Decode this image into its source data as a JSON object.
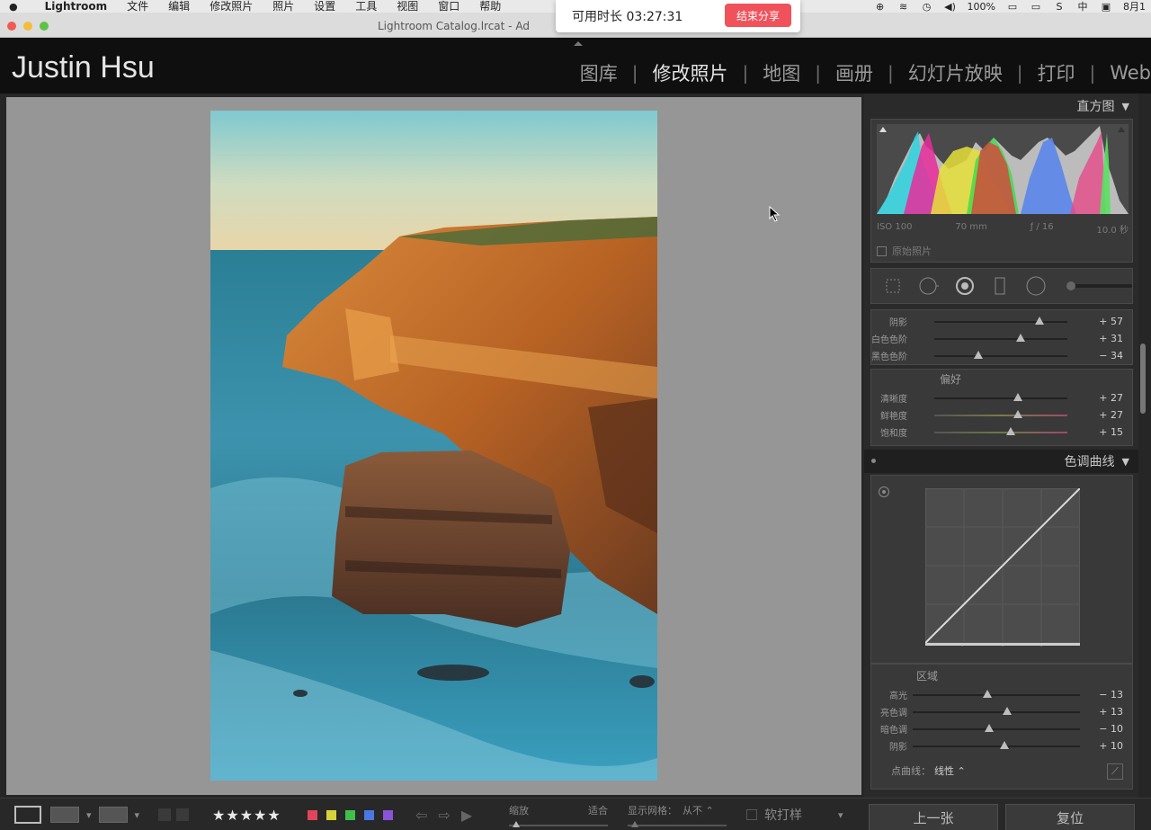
{
  "menubar": {
    "apple": "●",
    "app_name": "Lightroom",
    "items": [
      "文件",
      "编辑",
      "修改照片",
      "照片",
      "设置",
      "工具",
      "视图",
      "窗口",
      "帮助"
    ],
    "battery": "100%",
    "date": "8月1"
  },
  "window": {
    "title": "Lightroom Catalog.lrcat - Ad"
  },
  "share_popup": {
    "text": "可用时长 03:27:31",
    "button": "结束分享"
  },
  "identity_plate": "Justin Hsu",
  "modules": [
    {
      "label": "图库",
      "active": false
    },
    {
      "label": "修改照片",
      "active": true
    },
    {
      "label": "地图",
      "active": false
    },
    {
      "label": "画册",
      "active": false
    },
    {
      "label": "幻灯片放映",
      "active": false
    },
    {
      "label": "打印",
      "active": false
    },
    {
      "label": "Web",
      "active": false
    }
  ],
  "histogram": {
    "title": "直方图",
    "iso": "ISO 100",
    "focal": "70 mm",
    "aperture": "ƒ / 16",
    "shutter": "10.0 秒",
    "original_label": "原始照片"
  },
  "basic_tone": {
    "rows": [
      {
        "label": "阴影",
        "value": "+ 57",
        "pos": 0.79
      },
      {
        "label": "白色色阶",
        "value": "+ 31",
        "pos": 0.65
      },
      {
        "label": "黑色色阶",
        "value": "− 34",
        "pos": 0.33
      }
    ]
  },
  "presence": {
    "title": "偏好",
    "rows": [
      {
        "label": "清晰度",
        "value": "+ 27",
        "pos": 0.63
      },
      {
        "label": "鲜艳度",
        "value": "+ 27",
        "pos": 0.63
      },
      {
        "label": "饱和度",
        "value": "+ 15",
        "pos": 0.57
      }
    ]
  },
  "tone_curve": {
    "title": "色调曲线",
    "region_title": "区域",
    "rows": [
      {
        "label": "高光",
        "value": "− 13",
        "pos": 0.44
      },
      {
        "label": "亮色调",
        "value": "+ 13",
        "pos": 0.56
      },
      {
        "label": "暗色调",
        "value": "− 10",
        "pos": 0.45
      },
      {
        "label": "阴影",
        "value": "+ 10",
        "pos": 0.55
      }
    ],
    "point_curve_label": "点曲线：",
    "point_curve_value": "线性 ⌃"
  },
  "bottom": {
    "stars": "★★★★★",
    "zoom_label": "缩放",
    "fit_label": "适合",
    "grid_label": "显示网格：",
    "grid_value": "从不 ⌃",
    "softproof": "软打样",
    "prev": "上一张",
    "reset": "复位"
  },
  "colors": {
    "label_red": "#e0455a",
    "label_yellow": "#d8d23a",
    "label_green": "#3fbf4a",
    "label_blue": "#4a78e0",
    "label_purple": "#8a54d8",
    "share_button": "#f0525c"
  }
}
